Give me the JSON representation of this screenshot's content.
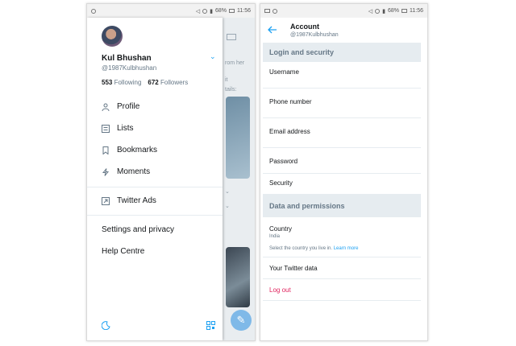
{
  "status_bar": {
    "battery_left": "68%",
    "battery_right": "68%",
    "time_left": "11:56",
    "time_right": "11:56"
  },
  "drawer": {
    "name": "Kul Bhushan",
    "handle": "@1987Kulbhushan",
    "following_count": "553",
    "following_label": "Following",
    "followers_count": "672",
    "followers_label": "Followers",
    "menu": [
      {
        "label": "Profile",
        "icon": "person-icon"
      },
      {
        "label": "Lists",
        "icon": "list-icon"
      },
      {
        "label": "Bookmarks",
        "icon": "bookmark-icon"
      },
      {
        "label": "Moments",
        "icon": "lightning-icon"
      },
      {
        "label": "Twitter Ads",
        "icon": "external-link-icon"
      }
    ],
    "settings_label": "Settings and privacy",
    "help_label": "Help Centre",
    "background_snippets": [
      "rom her",
      "it",
      "tails:"
    ]
  },
  "account": {
    "title": "Account",
    "handle": "@1987Kulbhushan",
    "login_section": "Login and security",
    "login_items": [
      "Username",
      "Phone number",
      "Email address",
      "Password",
      "Security"
    ],
    "data_section": "Data and permissions",
    "country_label": "Country",
    "country_value": "India",
    "country_hint": "Select the country you live in.",
    "learn_more": "Learn more",
    "twitter_data": "Your Twitter data",
    "logout": "Log out"
  },
  "colors": {
    "accent": "#1da1f2",
    "section_bg": "#e6ecf0",
    "logout": "#e0245e"
  }
}
